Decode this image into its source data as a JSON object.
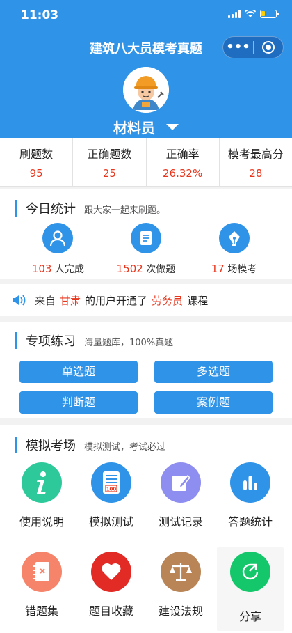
{
  "status": {
    "time": "11:03"
  },
  "header": {
    "title": "建筑八大员模考真题",
    "more_icon": "more-dots-icon",
    "target_icon": "target-icon",
    "role": "材料员"
  },
  "colors": {
    "primary": "#2f93e8",
    "accent_red": "#e8361d"
  },
  "stats": [
    {
      "label": "刷题数",
      "value": "95"
    },
    {
      "label": "正确题数",
      "value": "25"
    },
    {
      "label": "正确率",
      "value": "26.32%"
    },
    {
      "label": "模考最高分",
      "value": "28"
    }
  ],
  "today": {
    "title": "今日统计",
    "subtitle": "跟大家一起来刷题。",
    "items": [
      {
        "icon": "user-icon",
        "count": "103",
        "suffix": "人完成"
      },
      {
        "icon": "document-icon",
        "count": "1502",
        "suffix": "次做题"
      },
      {
        "icon": "pen-icon",
        "count": "17",
        "suffix": "场模考"
      }
    ]
  },
  "notice": {
    "icon": "speaker-icon",
    "p1": "来自",
    "place": "甘肃",
    "p2": "的用户开通了",
    "course": "劳务员",
    "p3": "课程"
  },
  "practice": {
    "title": "专项练习",
    "subtitle": "海量题库，100%真题",
    "buttons": [
      "单选题",
      "多选题",
      "判断题",
      "案例题"
    ]
  },
  "exam": {
    "title": "模拟考场",
    "subtitle": "模拟测试，考试必过",
    "tiles": [
      {
        "label": "使用说明",
        "icon": "info-icon",
        "color": "#2ec99a"
      },
      {
        "label": "模拟测试",
        "icon": "exam-paper-icon",
        "color": "#2f93e8"
      },
      {
        "label": "测试记录",
        "icon": "edit-note-icon",
        "color": "#8e8ef0"
      },
      {
        "label": "答题统计",
        "icon": "bar-chart-icon",
        "color": "#2f93e8"
      },
      {
        "label": "错题集",
        "icon": "error-book-icon",
        "color": "#f6846b"
      },
      {
        "label": "题目收藏",
        "icon": "heart-icon",
        "color": "#e22b25"
      },
      {
        "label": "建设法规",
        "icon": "scales-icon",
        "color": "#b98556"
      },
      {
        "label": "分享",
        "icon": "share-icon",
        "color": "#14c76a"
      }
    ]
  }
}
